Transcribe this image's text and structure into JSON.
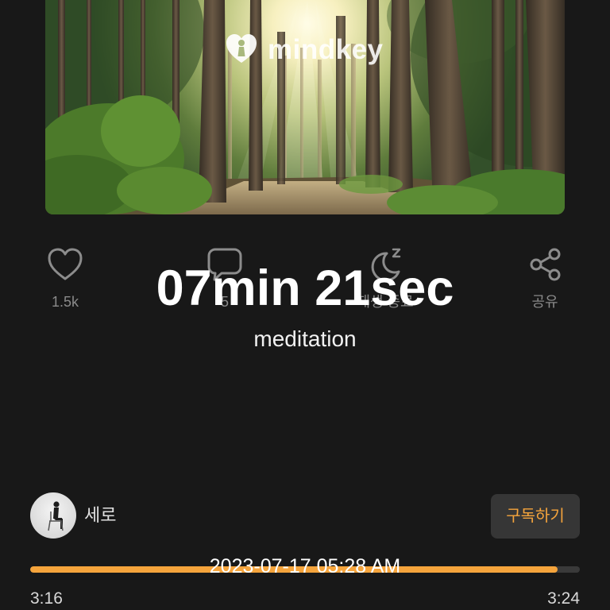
{
  "header_image": {
    "logo_text": "mindkey"
  },
  "actions": [
    {
      "icon": "heart-icon",
      "label": "1.5k"
    },
    {
      "icon": "comment-icon",
      "label": "5"
    },
    {
      "icon": "sleep-timer-icon",
      "label": "재생 종료"
    },
    {
      "icon": "share-icon",
      "label": "공유"
    }
  ],
  "overlay": {
    "duration": "07min 21sec",
    "category": "meditation",
    "timestamp": "2023-07-17 05:28 AM"
  },
  "creator": {
    "name": "세로",
    "subscribe_label": "구독하기"
  },
  "player": {
    "progress": 0.96,
    "elapsed": "3:16",
    "total": "3:24"
  },
  "colors": {
    "background": "#181818",
    "accent": "#f5a43c",
    "icon": "#8c8c8c",
    "button": "#363636",
    "track": "#3a3a3a"
  }
}
